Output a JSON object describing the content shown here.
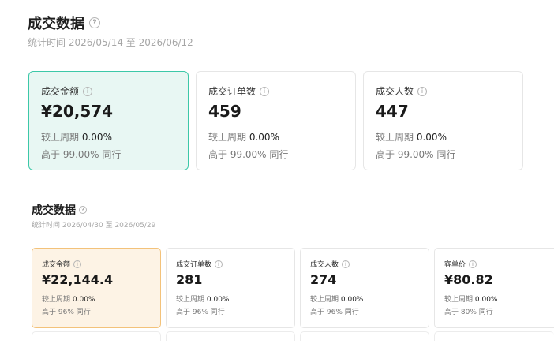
{
  "section1": {
    "title": "成交数据",
    "help_icon": "?",
    "period": "统计时间 2026/05/14 至 2026/06/12",
    "cards": [
      {
        "label": "成交金额",
        "info": "i",
        "value": "¥20,574",
        "compare_label": "较上周期",
        "compare_value": "0.00%",
        "peer": "高于 99.00% 同行"
      },
      {
        "label": "成交订单数",
        "info": "i",
        "value": "459",
        "compare_label": "较上周期",
        "compare_value": "0.00%",
        "peer": "高于 99.00% 同行"
      },
      {
        "label": "成交人数",
        "info": "i",
        "value": "447",
        "compare_label": "较上周期",
        "compare_value": "0.00%",
        "peer": "高于 99.00% 同行"
      }
    ]
  },
  "section2": {
    "title": "成交数据",
    "help_icon": "?",
    "period": "统计时间 2026/04/30 至 2026/05/29",
    "cards": [
      {
        "label": "成交金额",
        "info": "i",
        "value": "¥22,144.4",
        "compare_label": "较上周期",
        "compare_value": "0.00%",
        "peer": "高于 96% 同行"
      },
      {
        "label": "成交订单数",
        "info": "i",
        "value": "281",
        "compare_label": "较上周期",
        "compare_value": "0.00%",
        "peer": "高于 96% 同行"
      },
      {
        "label": "成交人数",
        "info": "i",
        "value": "274",
        "compare_label": "较上周期",
        "compare_value": "0.00%",
        "peer": "高于 96% 同行"
      },
      {
        "label": "客单价",
        "info": "i",
        "value": "¥80.82",
        "compare_label": "较上周期",
        "compare_value": "0.00%",
        "peer": "高于 80% 同行"
      }
    ]
  },
  "colors": {
    "active_green_border": "#3cc8a8",
    "active_green_bg": "#e8f7f3",
    "active_orange_border": "#f3c27a",
    "active_orange_bg": "#fdf3e5"
  }
}
